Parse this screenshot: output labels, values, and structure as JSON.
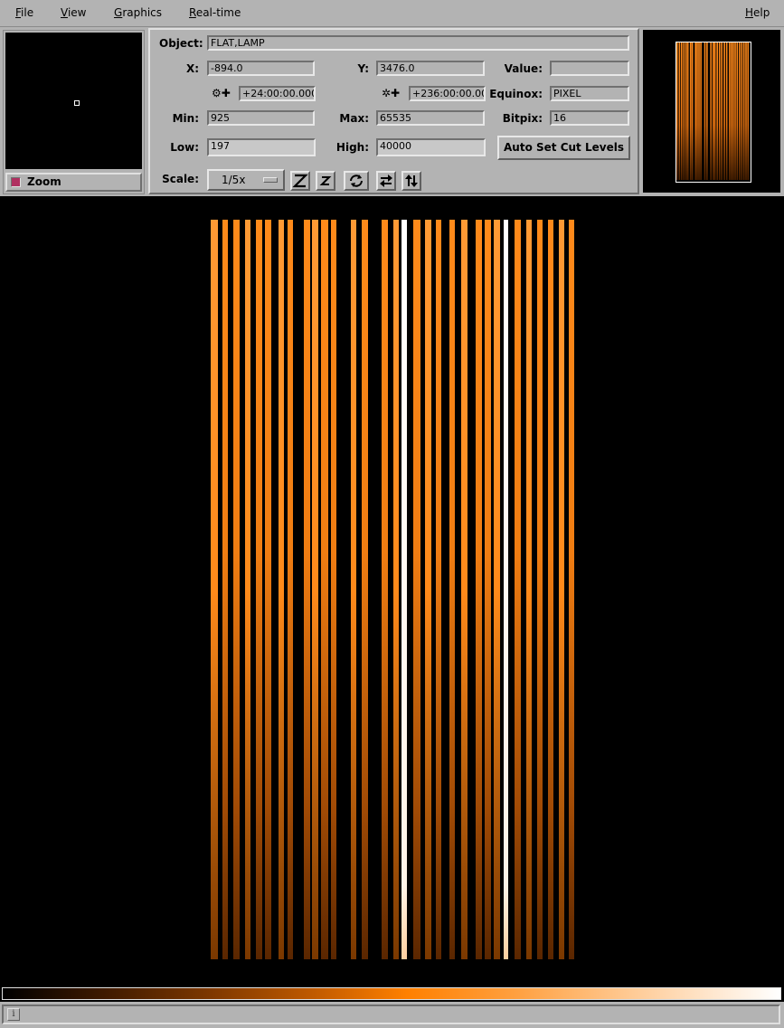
{
  "menubar": {
    "file": "File",
    "view": "View",
    "graphics": "Graphics",
    "realtime": "Real-time",
    "help": "Help"
  },
  "panner": {
    "zoom_label": "Zoom"
  },
  "info": {
    "object_label": "Object:",
    "object_value": "FLAT,LAMP",
    "x_label": "X:",
    "x_value": "-894.0",
    "y_label": "Y:",
    "y_value": "3476.0",
    "value_label": "Value:",
    "value_value": "",
    "ra_icon": "gear-cross-icon",
    "ra_value": "+24:00:00.000",
    "dec_icon": "star-cross-icon",
    "dec_value": "+236:00:00.00",
    "equinox_label": "Equinox:",
    "equinox_value": "PIXEL",
    "min_label": "Min:",
    "min_value": "925",
    "max_label": "Max:",
    "max_value": "65535",
    "bitpix_label": "Bitpix:",
    "bitpix_value": "16",
    "low_label": "Low:",
    "low_value": "197",
    "high_label": "High:",
    "high_value": "40000",
    "auto_cut_label": "Auto Set Cut Levels",
    "scale_label": "Scale:",
    "scale_value": "1/5x"
  },
  "toolbar_icons": [
    "zoom-in-icon",
    "zoom-out-icon",
    "rotate-icon",
    "flip-x-icon",
    "flip-y-icon"
  ],
  "colors": {
    "panel": "#b3b3b3",
    "stripe_orange": "#ff8a1a",
    "accent_check": "#b03060"
  }
}
